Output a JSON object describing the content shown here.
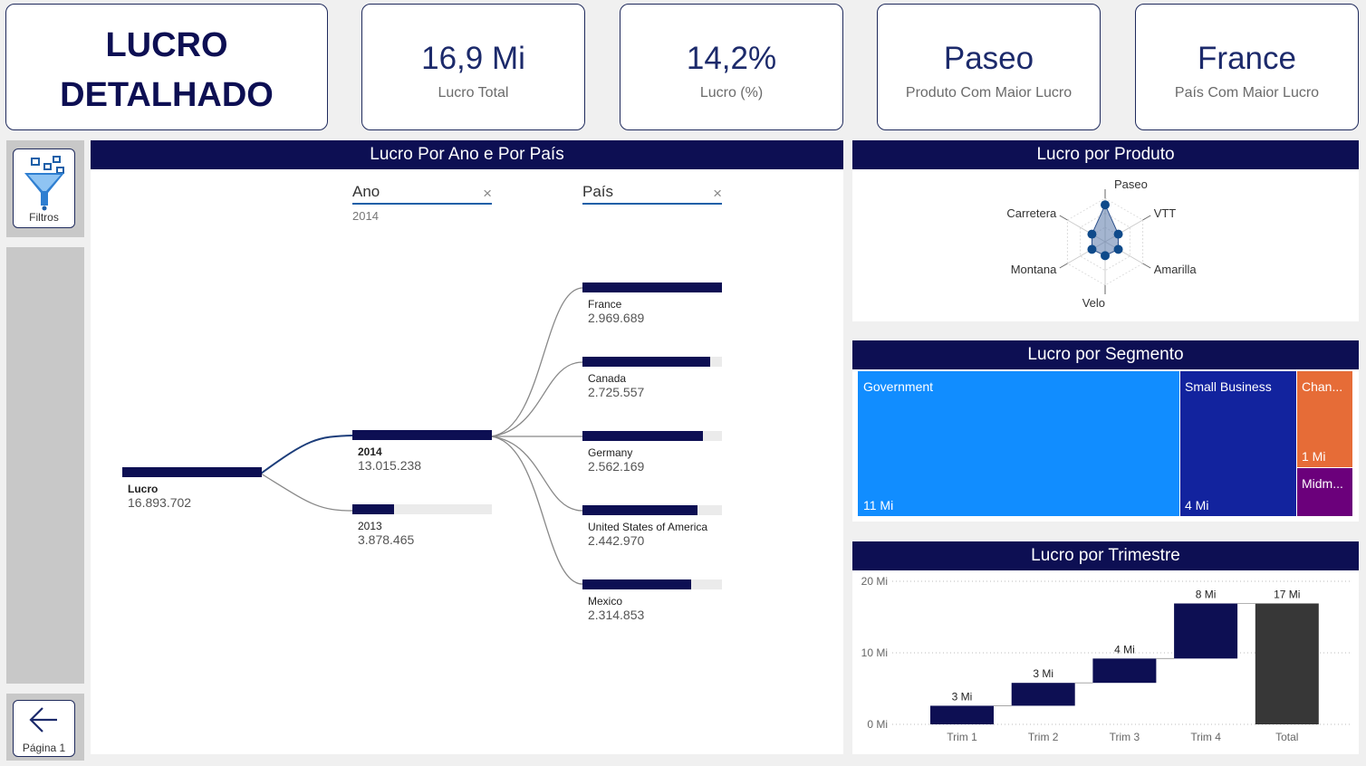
{
  "header": {
    "title_line1": "LUCRO",
    "title_line2": "DETALHADO",
    "kpis": [
      {
        "value": "16,9 Mi",
        "label": "Lucro Total"
      },
      {
        "value": "14,2%",
        "label": "Lucro (%)"
      },
      {
        "value": "Paseo",
        "label": "Produto Com Maior Lucro"
      },
      {
        "value": "France",
        "label": "País Com Maior Lucro"
      }
    ]
  },
  "sidebar": {
    "filter_label": "Filtros",
    "page_label": "Página 1"
  },
  "colors": {
    "navy": "#0d0f53",
    "accent": "#1c2a6b",
    "panel_bg": "#ffffff",
    "side_gray": "#c8c8c8"
  },
  "decomposition": {
    "title": "Lucro Por Ano e Por País",
    "col1": {
      "header": "Ano",
      "selection": "2014"
    },
    "col2": {
      "header": "País"
    },
    "root": {
      "label": "Lucro",
      "value": "16.893.702"
    },
    "years": [
      {
        "label": "2014",
        "value": "13.015.238",
        "fraction": 1.0,
        "selected": true
      },
      {
        "label": "2013",
        "value": "3.878.465",
        "fraction": 0.298,
        "selected": false
      }
    ],
    "countries": [
      {
        "label": "France",
        "value": "2.969.689",
        "fraction": 1.0
      },
      {
        "label": "Canada",
        "value": "2.725.557",
        "fraction": 0.918
      },
      {
        "label": "Germany",
        "value": "2.562.169",
        "fraction": 0.863
      },
      {
        "label": "United States of America",
        "value": "2.442.970",
        "fraction": 0.823
      },
      {
        "label": "Mexico",
        "value": "2.314.853",
        "fraction": 0.78
      }
    ]
  },
  "radar": {
    "title": "Lucro por Produto",
    "axes": [
      "Paseo",
      "VTT",
      "Amarilla",
      "Velo",
      "Montana",
      "Carretera"
    ],
    "values": [
      0.85,
      0.35,
      0.35,
      0.32,
      0.35,
      0.35
    ]
  },
  "treemap": {
    "title": "Lucro por Segmento",
    "tiles": [
      {
        "name": "Government",
        "value": "11 Mi",
        "color": "#118dff"
      },
      {
        "name": "Small Business",
        "value": "4 Mi",
        "color": "#12239e"
      },
      {
        "name": "Chan...",
        "value": "1 Mi",
        "color": "#e66c37"
      },
      {
        "name": "Midm...",
        "value": "",
        "color": "#6b007b"
      }
    ]
  },
  "chart_data": {
    "type": "bar",
    "subtype": "waterfall",
    "title": "Lucro por Trimestre",
    "categories": [
      "Trim 1",
      "Trim 2",
      "Trim 3",
      "Trim 4",
      "Total"
    ],
    "values": [
      2.6,
      3.2,
      3.4,
      7.7,
      16.9
    ],
    "data_labels": [
      "3 Mi",
      "3 Mi",
      "4 Mi",
      "8 Mi",
      "17 Mi"
    ],
    "yticks": [
      "0 Mi",
      "10 Mi",
      "20 Mi"
    ],
    "ylim": [
      0,
      20
    ],
    "grid": true,
    "colors": {
      "increase": "#0d0f53",
      "total": "#373737"
    }
  }
}
